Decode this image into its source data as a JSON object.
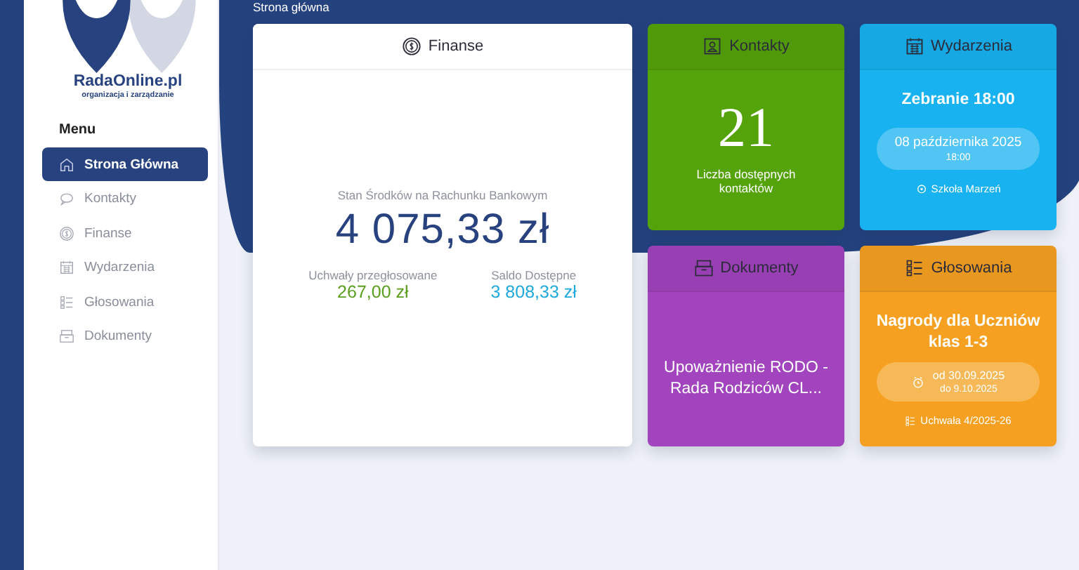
{
  "logo": {
    "name": "RadaOnline.pl",
    "tagline": "organizacja i zarządzanie"
  },
  "breadcrumb": "Strona główna",
  "sidebar": {
    "heading": "Menu",
    "items": [
      {
        "label": "Strona Główna",
        "selected": true
      },
      {
        "label": "Kontakty",
        "selected": false
      },
      {
        "label": "Finanse",
        "selected": false
      },
      {
        "label": "Wydarzenia",
        "selected": false
      },
      {
        "label": "Głosowania",
        "selected": false
      },
      {
        "label": "Dokumenty",
        "selected": false
      }
    ]
  },
  "cards": [
    {
      "kind": "finance",
      "title": "Finanse",
      "balance_label": "Stan Środków na Rachunku Bankowym",
      "balance": "4 075,33 zł",
      "stats": [
        {
          "label": "Uchwały przegłosowane",
          "value": "267,00 zł",
          "color": "#5a9e1e"
        },
        {
          "label": "Saldo Dostępne",
          "value": "3 808,33 zł",
          "color": "#1fa9dd"
        }
      ]
    },
    {
      "kind": "contacts",
      "title": "Kontakty",
      "color": "#55a30a",
      "count": "21",
      "caption": "Liczba dostępnych kontaktów"
    },
    {
      "kind": "event",
      "title": "Wydarzenia",
      "color": "#17b2ef",
      "headline": "Zebranie 18:00",
      "date": "08 października 2025",
      "time": "18:00",
      "place": "Szkoła Marzeń"
    },
    {
      "kind": "document",
      "title": "Dokumenty",
      "color": "#a144bd",
      "headline": "Upoważnienie RODO - Rada Rodziców CL..."
    },
    {
      "kind": "vote",
      "title": "Głosowania",
      "color": "#f5a021",
      "headline": "Nagrody dla Uczniów klas 1-3",
      "from": "od 30.09.2025",
      "to": "do 9.10.2025",
      "resolution": "Uchwała 4/2025-26"
    }
  ]
}
